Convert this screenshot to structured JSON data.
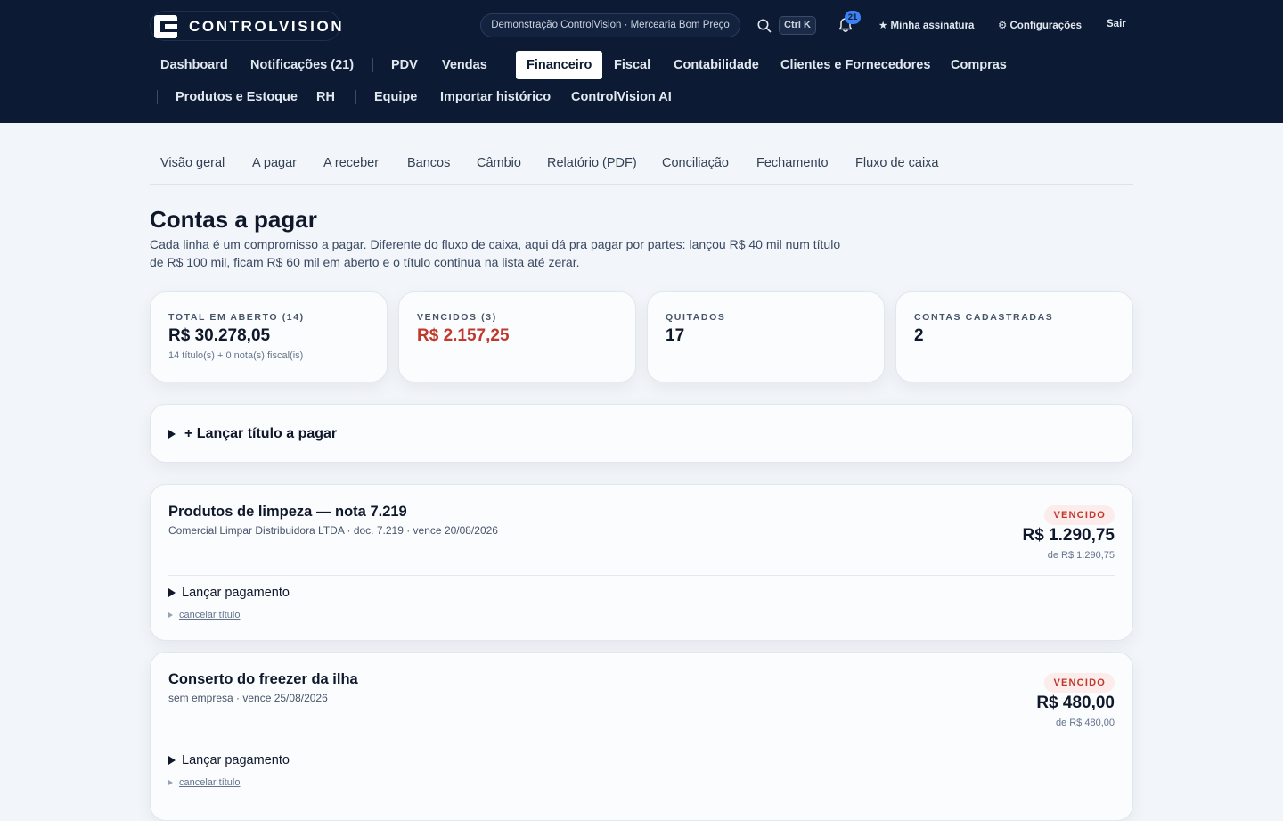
{
  "brand": {
    "name": "CONTROLVISION"
  },
  "header": {
    "company": "Demonstração ControlVision · Mercearia Bom Preço",
    "search_shortcut": "Ctrl K",
    "notifications_count": "21",
    "subscription": "★ Minha assinatura",
    "settings": "⚙ Configurações",
    "logout": "Sair"
  },
  "nav": {
    "items": [
      "Dashboard",
      "Notificações (21)",
      "PDV",
      "Vendas",
      "Financeiro",
      "Fiscal",
      "Contabilidade",
      "Clientes e Fornecedores",
      "Compras",
      "Produtos e Estoque",
      "RH",
      "Equipe",
      "Importar histórico",
      "ControlVision AI"
    ],
    "active": "Financeiro"
  },
  "subtabs": [
    "Visão geral",
    "A pagar",
    "A receber",
    "Bancos",
    "Câmbio",
    "Relatório (PDF)",
    "Conciliação",
    "Fechamento",
    "Fluxo de caixa"
  ],
  "page": {
    "title": "Contas a pagar",
    "description": "Cada linha é um compromisso a pagar. Diferente do fluxo de caixa, aqui dá pra pagar por partes: lançou R$ 40 mil num título de R$ 100 mil, ficam R$ 60 mil em aberto e o título continua na lista até zerar."
  },
  "stats": [
    {
      "label": "TOTAL EM ABERTO (14)",
      "value": "R$ 30.278,05",
      "sub": "14 título(s) + 0 nota(s) fiscal(is)"
    },
    {
      "label": "VENCIDOS (3)",
      "value": "R$ 2.157,25",
      "sub": ""
    },
    {
      "label": "QUITADOS",
      "value": "17",
      "sub": ""
    },
    {
      "label": "CONTAS CADASTRADAS",
      "value": "2",
      "sub": ""
    }
  ],
  "launch": {
    "label": "+ Lançar título a pagar"
  },
  "bills": [
    {
      "title": "Produtos de limpeza — nota 7.219",
      "meta": "Comercial Limpar Distribuidora LTDA · doc. 7.219 · vence 20/08/2026",
      "status": "VENCIDO",
      "amount": "R$ 1.290,75",
      "of_total": "de R$ 1.290,75",
      "pay_label": "Lançar pagamento",
      "cancel_label": "cancelar título"
    },
    {
      "title": "Conserto do freezer da ilha",
      "meta": "sem empresa · vence 25/08/2026",
      "status": "VENCIDO",
      "amount": "R$ 480,00",
      "of_total": "de R$ 480,00",
      "pay_label": "Lançar pagamento",
      "cancel_label": "cancelar título"
    }
  ],
  "colors": {
    "header_bg": "#0c1a33",
    "danger": "#c0392b",
    "page_bg": "#f2f5f9",
    "badge_blue": "#3b82f6"
  }
}
